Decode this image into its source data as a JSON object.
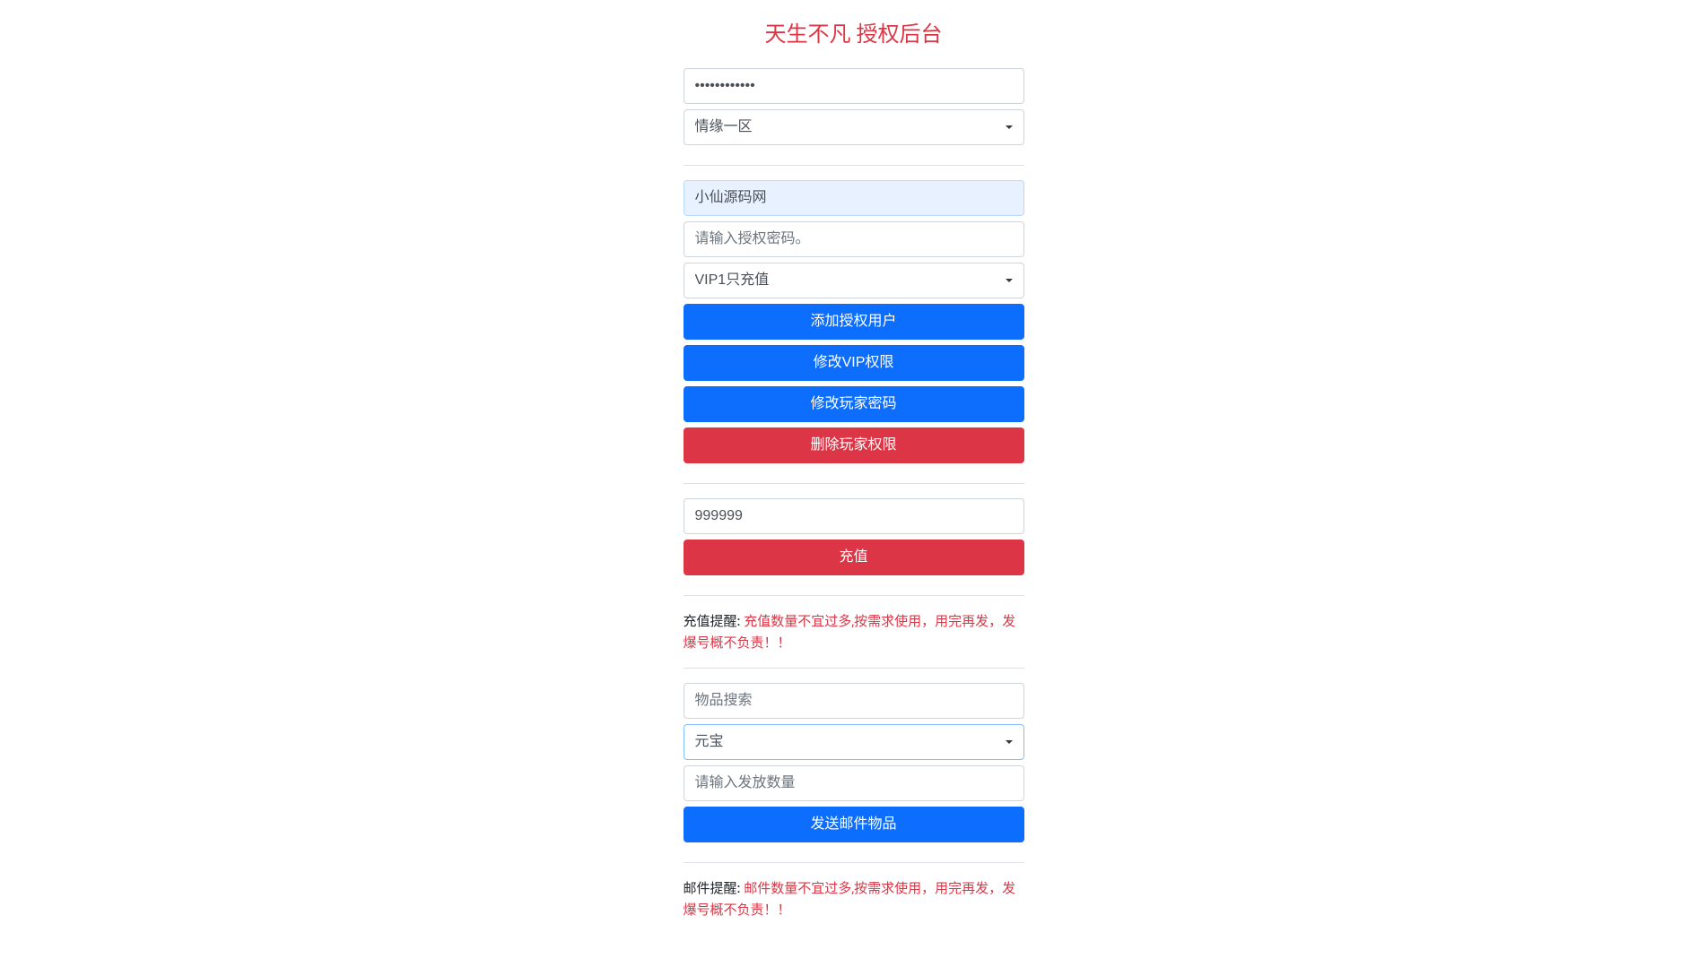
{
  "page_title": "天生不凡 授权后台",
  "section1": {
    "password_value": "••••••••••••",
    "server_selected": "情缘一区"
  },
  "section2": {
    "username_value": "小仙源码网",
    "auth_password_placeholder": "请输入授权密码。",
    "vip_selected": "VIP1只充值",
    "btn_add_auth": "添加授权用户",
    "btn_modify_vip": "修改VIP权限",
    "btn_modify_password": "修改玩家密码",
    "btn_delete_permission": "删除玩家权限"
  },
  "section3": {
    "amount_value": "999999",
    "btn_recharge": "充值"
  },
  "notice1": {
    "label": "充值提醒: ",
    "text": "充值数量不宜过多,按需求使用，用完再发，发爆号概不负责！！"
  },
  "section4": {
    "item_search_placeholder": "物品搜索",
    "item_selected": "元宝",
    "quantity_placeholder": "请输入发放数量",
    "btn_send_mail": "发送邮件物品"
  },
  "notice2": {
    "label": "邮件提醒: ",
    "text": "邮件数量不宜过多,按需求使用，用完再发，发爆号概不负责！！"
  }
}
